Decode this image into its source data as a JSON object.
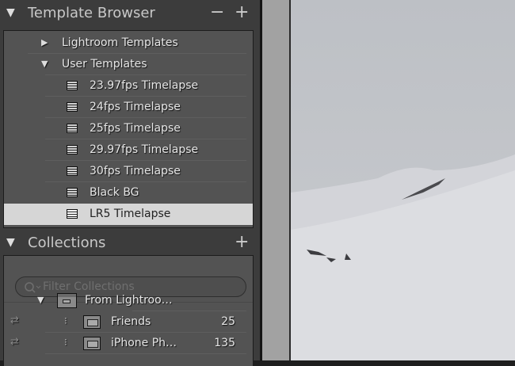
{
  "template_browser": {
    "title": "Template Browser",
    "minus": "−",
    "plus": "+",
    "folders": [
      {
        "label": "Lightroom Templates",
        "expanded": false
      },
      {
        "label": "User Templates",
        "expanded": true
      }
    ],
    "templates": [
      "23.97fps Timelapse",
      "24fps Timelapse",
      "25fps Timelapse",
      "29.97fps Timelapse",
      "30fps Timelapse",
      "Black BG",
      "LR5 Timelapse"
    ],
    "selected": "LR5 Timelapse"
  },
  "collections": {
    "title": "Collections",
    "plus": "+",
    "filter_placeholder": "Filter Collections",
    "set": "From Lightroo…",
    "items": [
      {
        "label": "Friends",
        "count": "25"
      },
      {
        "label": "iPhone Ph…",
        "count": "135"
      }
    ]
  },
  "icons": {
    "expand": "▼",
    "collapse": "▶",
    "sync": "⇄",
    "smart": "⁝"
  }
}
